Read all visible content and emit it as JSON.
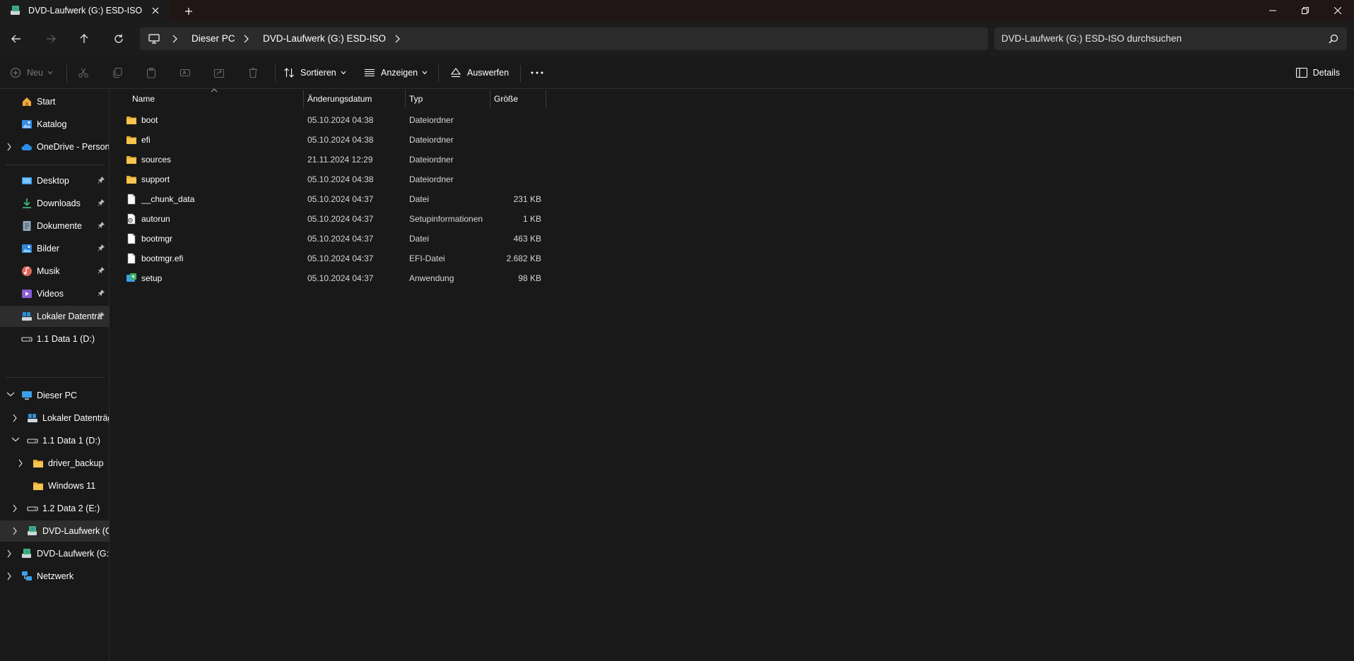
{
  "window": {
    "tab_title": "DVD-Laufwerk (G:) ESD-ISO"
  },
  "address": {
    "crumbs": [
      "Dieser PC",
      "DVD-Laufwerk (G:) ESD-ISO"
    ],
    "search_placeholder": "DVD-Laufwerk (G:) ESD-ISO durchsuchen"
  },
  "toolbar": {
    "new_label": "Neu",
    "sort_label": "Sortieren",
    "view_label": "Anzeigen",
    "eject_label": "Auswerfen",
    "details_label": "Details"
  },
  "columns": {
    "name": "Name",
    "date": "Änderungsdatum",
    "type": "Typ",
    "size": "Größe"
  },
  "files": [
    {
      "name": "boot",
      "date": "05.10.2024 04:38",
      "type": "Dateiordner",
      "size": "",
      "icon": "folder-icon"
    },
    {
      "name": "efi",
      "date": "05.10.2024 04:38",
      "type": "Dateiordner",
      "size": "",
      "icon": "folder-icon"
    },
    {
      "name": "sources",
      "date": "21.11.2024 12:29",
      "type": "Dateiordner",
      "size": "",
      "icon": "folder-icon"
    },
    {
      "name": "support",
      "date": "05.10.2024 04:38",
      "type": "Dateiordner",
      "size": "",
      "icon": "folder-icon"
    },
    {
      "name": "__chunk_data",
      "date": "05.10.2024 04:37",
      "type": "Datei",
      "size": "231 KB",
      "icon": "file-icon"
    },
    {
      "name": "autorun",
      "date": "05.10.2024 04:37",
      "type": "Setupinformationen",
      "size": "1 KB",
      "icon": "settings-file-icon"
    },
    {
      "name": "bootmgr",
      "date": "05.10.2024 04:37",
      "type": "Datei",
      "size": "463 KB",
      "icon": "file-icon"
    },
    {
      "name": "bootmgr.efi",
      "date": "05.10.2024 04:37",
      "type": "EFI-Datei",
      "size": "2.682 KB",
      "icon": "file-icon"
    },
    {
      "name": "setup",
      "date": "05.10.2024 04:37",
      "type": "Anwendung",
      "size": "98 KB",
      "icon": "setup-app-icon"
    }
  ],
  "sidebar": {
    "top": [
      {
        "label": "Start",
        "icon": "home-icon"
      },
      {
        "label": "Katalog",
        "icon": "gallery-icon"
      },
      {
        "label": "OneDrive - Persona",
        "icon": "onedrive-icon"
      }
    ],
    "quick": [
      {
        "label": "Desktop",
        "icon": "desktop-icon"
      },
      {
        "label": "Downloads",
        "icon": "download-icon"
      },
      {
        "label": "Dokumente",
        "icon": "documents-icon"
      },
      {
        "label": "Bilder",
        "icon": "pictures-icon"
      },
      {
        "label": "Musik",
        "icon": "music-icon"
      },
      {
        "label": "Videos",
        "icon": "videos-icon"
      },
      {
        "label": "Lokaler Datenträ",
        "icon": "local-drive-icon"
      },
      {
        "label": "1.1 Data 1 (D:)",
        "icon": "drive-icon"
      }
    ],
    "tree": [
      {
        "label": "Dieser PC",
        "icon": "this-pc-icon"
      },
      {
        "label": "Lokaler Datenträg",
        "icon": "local-drive-icon"
      },
      {
        "label": "1.1 Data 1 (D:)",
        "icon": "drive-icon"
      },
      {
        "label": "driver_backup",
        "icon": "folder-icon"
      },
      {
        "label": "Windows 11",
        "icon": "folder-icon"
      },
      {
        "label": "1.2 Data 2 (E:)",
        "icon": "drive-icon"
      },
      {
        "label": "DVD-Laufwerk (G:",
        "icon": "dvd-drive-icon"
      },
      {
        "label": "DVD-Laufwerk (G:)",
        "icon": "dvd-drive-icon"
      },
      {
        "label": "Netzwerk",
        "icon": "network-icon"
      }
    ]
  }
}
